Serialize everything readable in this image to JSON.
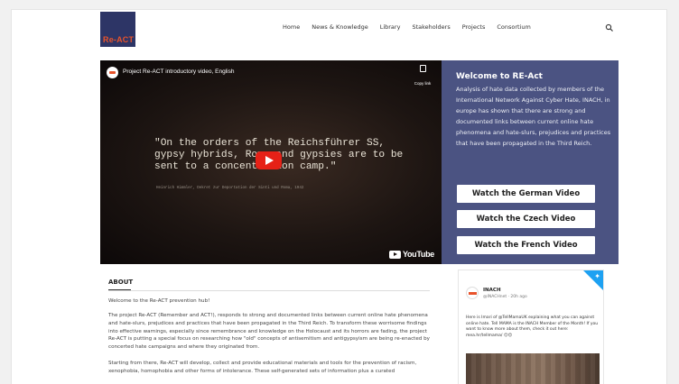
{
  "logo": {
    "text": "Re-ACT"
  },
  "nav": [
    "Home",
    "News & Knowledge",
    "Library",
    "Stakeholders",
    "Projects",
    "Consortium"
  ],
  "video": {
    "title": "Project Re-ACT introductory video, English",
    "copy_link": "Copy link",
    "quote_lines": [
      "\"On the orders of the Reichsführer SS,",
      "gypsy hybrids, Roma and gypsies are to be",
      "sent to a concentration camp.\""
    ],
    "citation": "Heinrich Himmler, Dekret zur Deportation der Sinti und Roma, 1942",
    "platform": "YouTube"
  },
  "welcome": {
    "heading": "Welcome to RE-Act",
    "body": "Analysis of hate data collected by members of the International Network Against Cyber Hate, INACH, in europe has shown that there are strong and documented links between current online hate phenomena and hate-slurs, prejudices and practices that have been propagated in the Third Reich.",
    "buttons": [
      "Watch the German Video",
      "Watch the Czech Video",
      "Watch the French Video"
    ]
  },
  "about": {
    "heading": "ABOUT",
    "p1": "Welcome to the Re-ACT prevention hub!",
    "p2": "The project Re-ACT (Remember and ACT!), responds to strong and documented links between current online hate phenomena and hate-slurs, prejudices and practices that have been propagated in the Third Reich. To transform these worrisome findings into effective warnings, especially since remembrance and knowledge on the Holocaust and its horrors are fading, the project Re-ACT is putting a special focus on researching how \"old\" concepts of antisemitism and antigypsyism are being re-enacted by concerted hate campaigns and where they originated from.",
    "p3": "Starting from there, Re-ACT will develop, collect and provide educational materials and tools for the prevention of racism, xenophobia, homophobia and other forms of intolerance. These self-generated sets of information plus a curated"
  },
  "tweet": {
    "name": "INACH",
    "handle": "@INACHnet · 20h ago",
    "text": "Here is Imari of @TellMamaUK explaining what you can against online hate. Tell MAMA is the INACH Member of the Month! If you want to know more about them, check it out here: mea.hr/tellmama/ 😊😊"
  },
  "colors": {
    "welcome_bg": "#4b5382",
    "accent": "#e8532b",
    "twitter": "#1da1f2"
  }
}
